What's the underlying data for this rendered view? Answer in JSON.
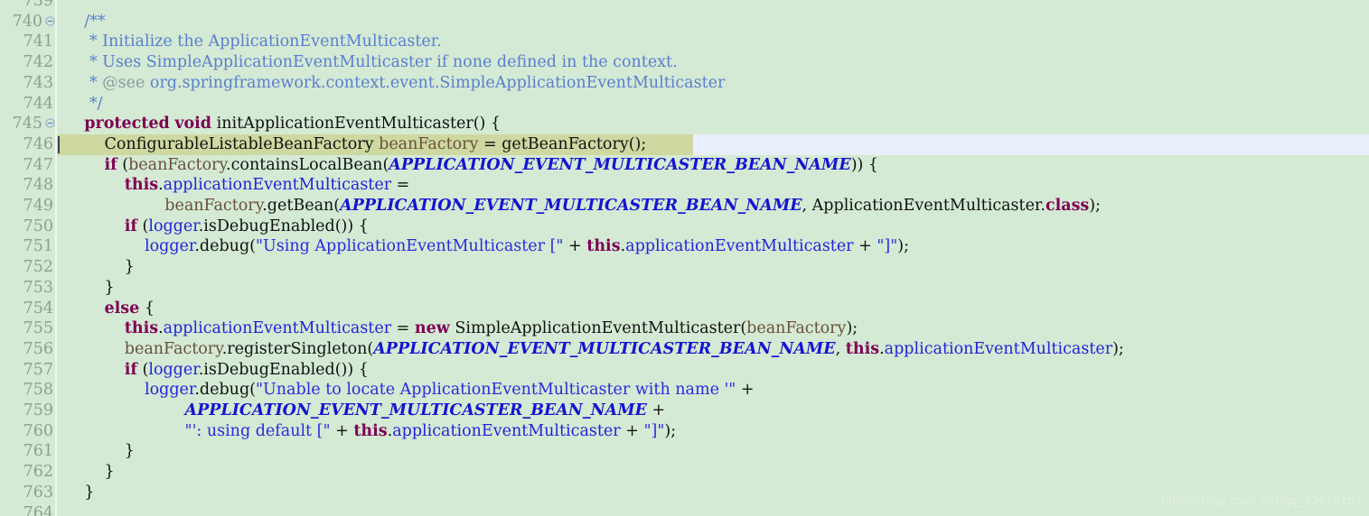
{
  "editor": {
    "background": "#d4ead4",
    "current_line_highlight": "#cdd9a1",
    "selection_tail_color": "#e8eefa",
    "gutter_background": "#d4ead4",
    "gutter_separator_color": "#f2f7f2",
    "line_number_color": "#8f9e92",
    "caret_line": 746,
    "language": "java"
  },
  "watermark": {
    "text": "https://blog.csdn.net/qq_43416157"
  },
  "gutter": {
    "lines": [
      {
        "number": "739",
        "fold": false,
        "partial": true
      },
      {
        "number": "740",
        "fold": true,
        "partial": false
      },
      {
        "number": "741",
        "fold": false,
        "partial": false
      },
      {
        "number": "742",
        "fold": false,
        "partial": false
      },
      {
        "number": "743",
        "fold": false,
        "partial": false
      },
      {
        "number": "744",
        "fold": false,
        "partial": false
      },
      {
        "number": "745",
        "fold": true,
        "partial": false
      },
      {
        "number": "746",
        "fold": false,
        "partial": false
      },
      {
        "number": "747",
        "fold": false,
        "partial": false
      },
      {
        "number": "748",
        "fold": false,
        "partial": false
      },
      {
        "number": "749",
        "fold": false,
        "partial": false
      },
      {
        "number": "750",
        "fold": false,
        "partial": false
      },
      {
        "number": "751",
        "fold": false,
        "partial": false
      },
      {
        "number": "752",
        "fold": false,
        "partial": false
      },
      {
        "number": "753",
        "fold": false,
        "partial": false
      },
      {
        "number": "754",
        "fold": false,
        "partial": false
      },
      {
        "number": "755",
        "fold": false,
        "partial": false
      },
      {
        "number": "756",
        "fold": false,
        "partial": false
      },
      {
        "number": "757",
        "fold": false,
        "partial": false
      },
      {
        "number": "758",
        "fold": false,
        "partial": false
      },
      {
        "number": "759",
        "fold": false,
        "partial": false
      },
      {
        "number": "760",
        "fold": false,
        "partial": false
      },
      {
        "number": "761",
        "fold": false,
        "partial": false
      },
      {
        "number": "762",
        "fold": false,
        "partial": false
      },
      {
        "number": "763",
        "fold": false,
        "partial": false
      },
      {
        "number": "764",
        "fold": false,
        "partial": true
      }
    ]
  },
  "code": {
    "lines": [
      {
        "number": "739",
        "plain": "",
        "tokens": []
      },
      {
        "number": "740",
        "plain": "    /**",
        "tokens": [
          {
            "t": "    ",
            "c": "punc"
          },
          {
            "t": "/**",
            "c": "cmt"
          }
        ]
      },
      {
        "number": "741",
        "plain": "     * Initialize the ApplicationEventMulticaster.",
        "tokens": [
          {
            "t": "     * Initialize the ApplicationEventMulticaster.",
            "c": "cmt"
          }
        ]
      },
      {
        "number": "742",
        "plain": "     * Uses SimpleApplicationEventMulticaster if none defined in the context.",
        "tokens": [
          {
            "t": "     * Uses SimpleApplicationEventMulticaster if none defined in the context.",
            "c": "cmt"
          }
        ]
      },
      {
        "number": "743",
        "plain": "     * @see org.springframework.context.event.SimpleApplicationEventMulticaster",
        "tokens": [
          {
            "t": "     * ",
            "c": "cmt"
          },
          {
            "t": "@see",
            "c": "cmt-tag"
          },
          {
            "t": " org.springframework.context.event.SimpleApplicationEventMulticaster",
            "c": "cmt"
          }
        ]
      },
      {
        "number": "744",
        "plain": "     */",
        "tokens": [
          {
            "t": "     */",
            "c": "cmt"
          }
        ]
      },
      {
        "number": "745",
        "plain": "    protected void initApplicationEventMulticaster() {",
        "tokens": [
          {
            "t": "    ",
            "c": "punc"
          },
          {
            "t": "protected",
            "c": "kw"
          },
          {
            "t": " ",
            "c": "punc"
          },
          {
            "t": "void",
            "c": "kw"
          },
          {
            "t": " initApplicationEventMulticaster() {",
            "c": "ident"
          }
        ]
      },
      {
        "number": "746",
        "plain": "        ConfigurableListableBeanFactory beanFactory = getBeanFactory();",
        "tokens": [
          {
            "t": "        ConfigurableListableBeanFactory ",
            "c": "ident"
          },
          {
            "t": "beanFactory",
            "c": "local"
          },
          {
            "t": " = getBeanFactory();",
            "c": "ident"
          }
        ]
      },
      {
        "number": "747",
        "plain": "        if (beanFactory.containsLocalBean(APPLICATION_EVENT_MULTICASTER_BEAN_NAME)) {",
        "tokens": [
          {
            "t": "        ",
            "c": "punc"
          },
          {
            "t": "if",
            "c": "kw"
          },
          {
            "t": " (",
            "c": "ident"
          },
          {
            "t": "beanFactory",
            "c": "local"
          },
          {
            "t": ".containsLocalBean(",
            "c": "ident"
          },
          {
            "t": "APPLICATION_EVENT_MULTICASTER_BEAN_NAME",
            "c": "constf"
          },
          {
            "t": ")) {",
            "c": "ident"
          }
        ]
      },
      {
        "number": "748",
        "plain": "            this.applicationEventMulticaster =",
        "tokens": [
          {
            "t": "            ",
            "c": "punc"
          },
          {
            "t": "this",
            "c": "kw"
          },
          {
            "t": ".",
            "c": "ident"
          },
          {
            "t": "applicationEventMulticaster",
            "c": "field"
          },
          {
            "t": " =",
            "c": "ident"
          }
        ]
      },
      {
        "number": "749",
        "plain": "                    beanFactory.getBean(APPLICATION_EVENT_MULTICASTER_BEAN_NAME, ApplicationEventMulticaster.class);",
        "tokens": [
          {
            "t": "                    ",
            "c": "punc"
          },
          {
            "t": "beanFactory",
            "c": "local"
          },
          {
            "t": ".getBean(",
            "c": "ident"
          },
          {
            "t": "APPLICATION_EVENT_MULTICASTER_BEAN_NAME",
            "c": "constf"
          },
          {
            "t": ", ApplicationEventMulticaster.",
            "c": "ident"
          },
          {
            "t": "class",
            "c": "kw"
          },
          {
            "t": ");",
            "c": "ident"
          }
        ]
      },
      {
        "number": "750",
        "plain": "            if (logger.isDebugEnabled()) {",
        "tokens": [
          {
            "t": "            ",
            "c": "punc"
          },
          {
            "t": "if",
            "c": "kw"
          },
          {
            "t": " (",
            "c": "ident"
          },
          {
            "t": "logger",
            "c": "field"
          },
          {
            "t": ".isDebugEnabled()) {",
            "c": "ident"
          }
        ]
      },
      {
        "number": "751",
        "plain": "                logger.debug(\"Using ApplicationEventMulticaster [\" + this.applicationEventMulticaster + \"]\");",
        "tokens": [
          {
            "t": "                ",
            "c": "punc"
          },
          {
            "t": "logger",
            "c": "field"
          },
          {
            "t": ".debug(",
            "c": "ident"
          },
          {
            "t": "\"Using ApplicationEventMulticaster [\"",
            "c": "str"
          },
          {
            "t": " + ",
            "c": "ident"
          },
          {
            "t": "this",
            "c": "kw"
          },
          {
            "t": ".",
            "c": "ident"
          },
          {
            "t": "applicationEventMulticaster",
            "c": "field"
          },
          {
            "t": " + ",
            "c": "ident"
          },
          {
            "t": "\"]\"",
            "c": "str"
          },
          {
            "t": ");",
            "c": "ident"
          }
        ]
      },
      {
        "number": "752",
        "plain": "            }",
        "tokens": [
          {
            "t": "            }",
            "c": "ident"
          }
        ]
      },
      {
        "number": "753",
        "plain": "        }",
        "tokens": [
          {
            "t": "        }",
            "c": "ident"
          }
        ]
      },
      {
        "number": "754",
        "plain": "        else {",
        "tokens": [
          {
            "t": "        ",
            "c": "punc"
          },
          {
            "t": "else",
            "c": "kw"
          },
          {
            "t": " {",
            "c": "ident"
          }
        ]
      },
      {
        "number": "755",
        "plain": "            this.applicationEventMulticaster = new SimpleApplicationEventMulticaster(beanFactory);",
        "tokens": [
          {
            "t": "            ",
            "c": "punc"
          },
          {
            "t": "this",
            "c": "kw"
          },
          {
            "t": ".",
            "c": "ident"
          },
          {
            "t": "applicationEventMulticaster",
            "c": "field"
          },
          {
            "t": " = ",
            "c": "ident"
          },
          {
            "t": "new",
            "c": "kw"
          },
          {
            "t": " SimpleApplicationEventMulticaster(",
            "c": "ident"
          },
          {
            "t": "beanFactory",
            "c": "local"
          },
          {
            "t": ");",
            "c": "ident"
          }
        ]
      },
      {
        "number": "756",
        "plain": "            beanFactory.registerSingleton(APPLICATION_EVENT_MULTICASTER_BEAN_NAME, this.applicationEventMulticaster);",
        "tokens": [
          {
            "t": "            ",
            "c": "punc"
          },
          {
            "t": "beanFactory",
            "c": "local"
          },
          {
            "t": ".registerSingleton(",
            "c": "ident"
          },
          {
            "t": "APPLICATION_EVENT_MULTICASTER_BEAN_NAME",
            "c": "constf"
          },
          {
            "t": ", ",
            "c": "ident"
          },
          {
            "t": "this",
            "c": "kw"
          },
          {
            "t": ".",
            "c": "ident"
          },
          {
            "t": "applicationEventMulticaster",
            "c": "field"
          },
          {
            "t": ");",
            "c": "ident"
          }
        ]
      },
      {
        "number": "757",
        "plain": "            if (logger.isDebugEnabled()) {",
        "tokens": [
          {
            "t": "            ",
            "c": "punc"
          },
          {
            "t": "if",
            "c": "kw"
          },
          {
            "t": " (",
            "c": "ident"
          },
          {
            "t": "logger",
            "c": "field"
          },
          {
            "t": ".isDebugEnabled()) {",
            "c": "ident"
          }
        ]
      },
      {
        "number": "758",
        "plain": "                logger.debug(\"Unable to locate ApplicationEventMulticaster with name '\" +",
        "tokens": [
          {
            "t": "                ",
            "c": "punc"
          },
          {
            "t": "logger",
            "c": "field"
          },
          {
            "t": ".debug(",
            "c": "ident"
          },
          {
            "t": "\"Unable to locate ApplicationEventMulticaster with name '\"",
            "c": "str"
          },
          {
            "t": " +",
            "c": "ident"
          }
        ]
      },
      {
        "number": "759",
        "plain": "                        APPLICATION_EVENT_MULTICASTER_BEAN_NAME +",
        "tokens": [
          {
            "t": "                        ",
            "c": "punc"
          },
          {
            "t": "APPLICATION_EVENT_MULTICASTER_BEAN_NAME",
            "c": "constf"
          },
          {
            "t": " +",
            "c": "ident"
          }
        ]
      },
      {
        "number": "760",
        "plain": "                        \"': using default [\" + this.applicationEventMulticaster + \"]\");",
        "tokens": [
          {
            "t": "                        ",
            "c": "punc"
          },
          {
            "t": "\"': using default [\"",
            "c": "str"
          },
          {
            "t": " + ",
            "c": "ident"
          },
          {
            "t": "this",
            "c": "kw"
          },
          {
            "t": ".",
            "c": "ident"
          },
          {
            "t": "applicationEventMulticaster",
            "c": "field"
          },
          {
            "t": " + ",
            "c": "ident"
          },
          {
            "t": "\"]\"",
            "c": "str"
          },
          {
            "t": ");",
            "c": "ident"
          }
        ]
      },
      {
        "number": "761",
        "plain": "            }",
        "tokens": [
          {
            "t": "            }",
            "c": "ident"
          }
        ]
      },
      {
        "number": "762",
        "plain": "        }",
        "tokens": [
          {
            "t": "        }",
            "c": "ident"
          }
        ]
      },
      {
        "number": "763",
        "plain": "    }",
        "tokens": [
          {
            "t": "    }",
            "c": "ident"
          }
        ]
      },
      {
        "number": "764",
        "plain": "",
        "tokens": []
      }
    ]
  }
}
